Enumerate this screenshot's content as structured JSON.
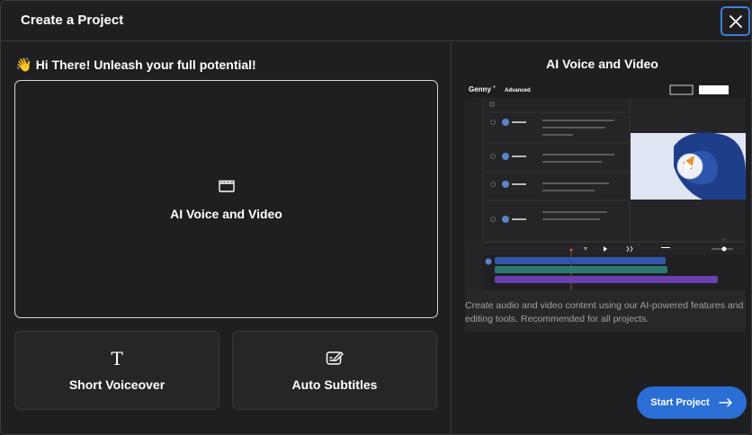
{
  "header": {
    "title": "Create a Project"
  },
  "greeting": {
    "emoji": "👋",
    "text": "Hi There! Unleash your full potential!"
  },
  "options": {
    "main": {
      "label": "AI Voice and Video",
      "icon": "clapperboard-icon"
    },
    "voiceover": {
      "label": "Short Voiceover",
      "icon": "text-t-icon"
    },
    "subtitles": {
      "label": "Auto Subtitles",
      "icon": "subtitles-edit-icon"
    }
  },
  "preview": {
    "title": "AI Voice and Video",
    "app_logo": "Genny",
    "app_mode": "Advanced",
    "description": "Create audio and video content using our AI-powered features and editing tools. Recommended for all projects."
  },
  "actions": {
    "start_label": "Start Project"
  },
  "colors": {
    "accent": "#2b6fd6",
    "focus_ring": "#3f7fd6",
    "background": "#1f1f21"
  }
}
